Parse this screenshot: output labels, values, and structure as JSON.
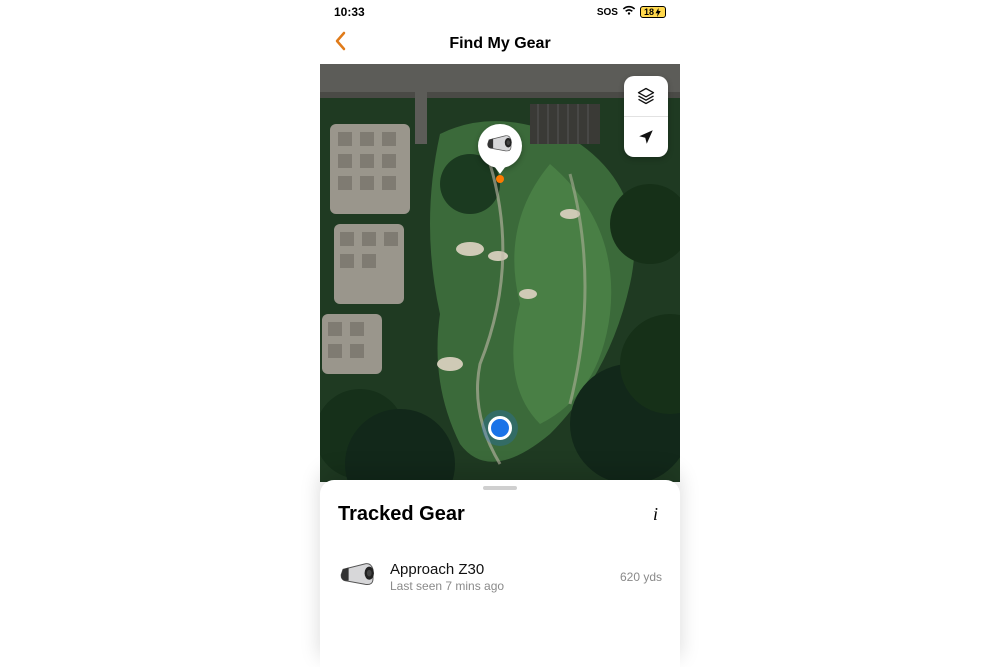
{
  "status": {
    "time": "10:33",
    "sos_label": "SOS",
    "battery": "18"
  },
  "nav": {
    "title": "Find My Gear"
  },
  "sheet": {
    "title": "Tracked Gear"
  },
  "gear": {
    "items": [
      {
        "name": "Approach Z30",
        "subtitle": "Last seen 7 mins ago",
        "distance": "620 yds"
      }
    ]
  }
}
